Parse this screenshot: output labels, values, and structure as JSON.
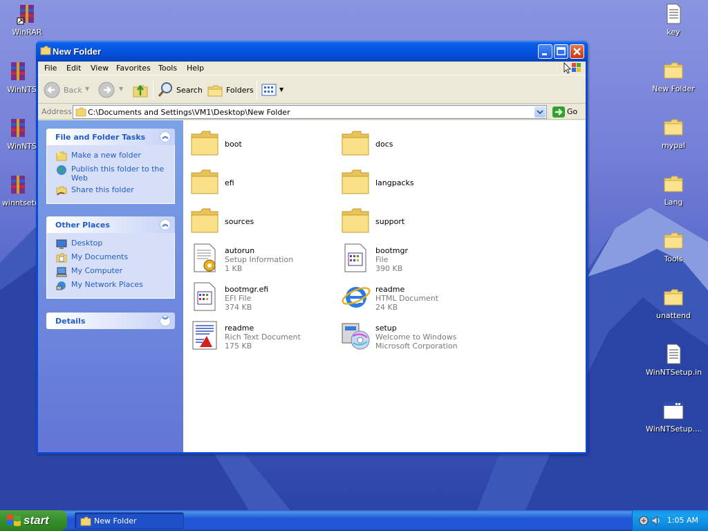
{
  "desktop": {
    "icons_left": [
      {
        "label": "WinRAR",
        "icon": "winrar-shortcut-icon"
      },
      {
        "label": "WinNTSet",
        "icon": "winrar-archive-icon"
      },
      {
        "label": "WinNTSet",
        "icon": "winrar-archive-icon"
      },
      {
        "label": "winntsetup",
        "icon": "winrar-archive-icon"
      }
    ],
    "icons_right": [
      {
        "label": "key",
        "icon": "text-file-icon"
      },
      {
        "label": "New Folder",
        "icon": "folder-icon"
      },
      {
        "label": "mypal",
        "icon": "folder-icon"
      },
      {
        "label": "Lang",
        "icon": "folder-icon"
      },
      {
        "label": "Tools",
        "icon": "folder-icon"
      },
      {
        "label": "unattend",
        "icon": "folder-icon"
      },
      {
        "label": "WinNTSetup.ini",
        "icon": "ini-file-icon"
      },
      {
        "label": "WinNTSetup....",
        "icon": "application-window-icon"
      }
    ]
  },
  "window": {
    "title": "New Folder",
    "menu": [
      "File",
      "Edit",
      "View",
      "Favorites",
      "Tools",
      "Help"
    ],
    "toolbar": {
      "back": "Back",
      "search": "Search",
      "folders": "Folders"
    },
    "address": {
      "label": "Address",
      "value": "C:\\Documents and Settings\\VM1\\Desktop\\New Folder",
      "go": "Go"
    },
    "tasks_panel": {
      "title": "File and Folder Tasks",
      "links": [
        "Make a new folder",
        "Publish this folder to the Web",
        "Share this folder"
      ]
    },
    "places_panel": {
      "title": "Other Places",
      "links": [
        "Desktop",
        "My Documents",
        "My Computer",
        "My Network Places"
      ]
    },
    "details_panel": {
      "title": "Details"
    },
    "files": [
      {
        "name": "boot",
        "type": "",
        "size": "",
        "icon": "folder-icon"
      },
      {
        "name": "docs",
        "type": "",
        "size": "",
        "icon": "folder-icon"
      },
      {
        "name": "efi",
        "type": "",
        "size": "",
        "icon": "folder-icon"
      },
      {
        "name": "langpacks",
        "type": "",
        "size": "",
        "icon": "folder-icon"
      },
      {
        "name": "sources",
        "type": "",
        "size": "",
        "icon": "folder-icon"
      },
      {
        "name": "support",
        "type": "",
        "size": "",
        "icon": "folder-icon"
      },
      {
        "name": "autorun",
        "type": "Setup Information",
        "size": "1 KB",
        "icon": "setup-information-icon"
      },
      {
        "name": "bootmgr",
        "type": "File",
        "size": "390 KB",
        "icon": "generic-file-icon"
      },
      {
        "name": "bootmgr.efi",
        "type": "EFI File",
        "size": "374 KB",
        "icon": "generic-file-icon"
      },
      {
        "name": "readme",
        "type": "HTML Document",
        "size": "24 KB",
        "icon": "internet-explorer-icon"
      },
      {
        "name": "readme",
        "type": "Rich Text Document",
        "size": "175 KB",
        "icon": "rich-text-icon"
      },
      {
        "name": "setup",
        "type": "Welcome to Windows",
        "size": "Microsoft Corporation",
        "icon": "setup-installer-icon"
      }
    ]
  },
  "taskbar": {
    "start": "start",
    "task": "New Folder",
    "clock": "1:05 AM"
  },
  "colors": {
    "link": "#215dc6",
    "titlebar": "#0553e0",
    "taskbar": "#2157d7",
    "start": "#3d9633"
  }
}
